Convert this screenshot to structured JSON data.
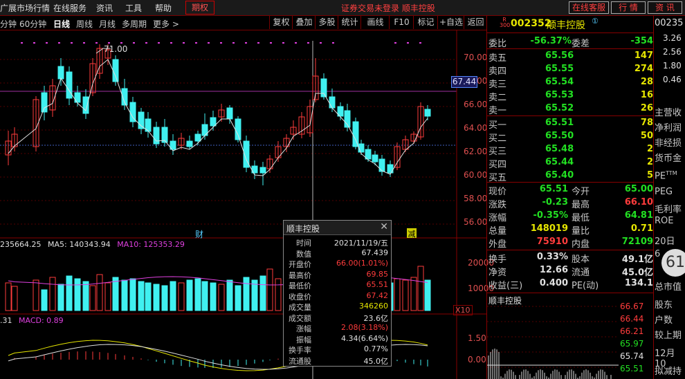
{
  "menu": {
    "items": [
      "广展市场行情",
      "在线服务",
      "资讯",
      "工具",
      "帮助"
    ],
    "active": "期权",
    "center_status": "证券交易未登录  顺丰控股",
    "buttons": [
      "在线客服",
      "行 情",
      "资 讯"
    ]
  },
  "toolbar": {
    "periods": [
      "分钟",
      "60分钟",
      "日线",
      "周线",
      "月线",
      "多周期",
      "更多 >"
    ],
    "active_period": "日线",
    "tools": [
      "复权",
      "叠加",
      "多股",
      "统计",
      "画线",
      "F10",
      "标记",
      "+自选",
      "返回"
    ]
  },
  "price_axis": [
    "70.00",
    "68.00",
    "66.00",
    "64.00",
    "62.00",
    "60.00",
    "58.00",
    "56.00"
  ],
  "price_marker": "67.44",
  "max_label": "71.00",
  "markers": {
    "cai": "财",
    "jian": "减"
  },
  "volume": {
    "legend_vol": "235664.25",
    "ma5_label": "MA5: 140343.94",
    "ma10_label": "MA10: 125353.29",
    "axis": [
      "20000",
      "10000"
    ],
    "unit": "X10"
  },
  "macd": {
    "legend_left": ".31",
    "macd_label": "MACD: 0.89",
    "axis": [
      "1.50",
      "0.00"
    ]
  },
  "tooltip": {
    "title": "顺丰控股",
    "rows": [
      {
        "label": "时间",
        "value": "2021/11/19/五",
        "color": "#e0e0e0"
      },
      {
        "label": "数值",
        "value": "67.439",
        "color": "#e0e0e0"
      },
      {
        "label": "开盘价",
        "value": "66.00(1.01%)",
        "color": "#ff3c3c"
      },
      {
        "label": "最高价",
        "value": "69.85",
        "color": "#ff3c3c"
      },
      {
        "label": "最低价",
        "value": "65.51",
        "color": "#ff3c3c"
      },
      {
        "label": "收盘价",
        "value": "67.42",
        "color": "#ff3c3c"
      },
      {
        "label": "成交量",
        "value": "346260",
        "color": "#e6e600"
      },
      {
        "label": "成交额",
        "value": "23.6亿",
        "color": "#e0e0e0"
      },
      {
        "label": "涨幅",
        "value": "2.08(3.18%)",
        "color": "#ff3c3c"
      },
      {
        "label": "振幅",
        "value": "4.34(6.64%)",
        "color": "#e0e0e0"
      },
      {
        "label": "换手率",
        "value": "0.77%",
        "color": "#e0e0e0"
      },
      {
        "label": "流通股",
        "value": "45.0亿",
        "color": "#e0e0e0"
      }
    ]
  },
  "stock": {
    "badge_top": "R",
    "badge_bottom": "300",
    "code": "002352",
    "name": "顺丰控股",
    "info_icon": "①",
    "weibi_label": "委比",
    "weibi": "-56.37%",
    "weicha_label": "委差",
    "weicha": "-354",
    "sells": [
      {
        "label": "卖五",
        "price": "65.56",
        "vol": "147"
      },
      {
        "label": "卖四",
        "price": "65.55",
        "vol": "274"
      },
      {
        "label": "卖三",
        "price": "65.54",
        "vol": "28"
      },
      {
        "label": "卖二",
        "price": "65.53",
        "vol": "16"
      },
      {
        "label": "卖一",
        "price": "65.52",
        "vol": "26"
      }
    ],
    "buys": [
      {
        "label": "买一",
        "price": "65.51",
        "vol": "78"
      },
      {
        "label": "买二",
        "price": "65.50",
        "vol": "50"
      },
      {
        "label": "买三",
        "price": "65.48",
        "vol": "2"
      },
      {
        "label": "买四",
        "price": "65.44",
        "vol": "2"
      },
      {
        "label": "买五",
        "price": "65.40",
        "vol": "5"
      }
    ],
    "quote": [
      {
        "l1": "现价",
        "v1": "65.51",
        "c1": "#22e022",
        "l2": "今开",
        "v2": "65.00",
        "c2": "#22e022"
      },
      {
        "l1": "涨跌",
        "v1": "-0.23",
        "c1": "#22e022",
        "l2": "最高",
        "v2": "66.10",
        "c2": "#ff3c3c"
      },
      {
        "l1": "涨幅",
        "v1": "-0.35%",
        "c1": "#22e022",
        "l2": "最低",
        "v2": "64.81",
        "c2": "#22e022"
      },
      {
        "l1": "总量",
        "v1": "148019",
        "c1": "#e6e600",
        "l2": "量比",
        "v2": "0.71",
        "c2": "#e6e600"
      },
      {
        "l1": "外盘",
        "v1": "75910",
        "c1": "#ff3c3c",
        "l2": "内盘",
        "v2": "72109",
        "c2": "#22e022"
      }
    ],
    "stats": [
      {
        "l1": "换手",
        "v1": "0.33%",
        "l2": "股本",
        "v2": "49.1亿"
      },
      {
        "l1": "净资",
        "v1": "12.66",
        "l2": "流通",
        "v2": "45.0亿"
      },
      {
        "l1": "收益(三)",
        "v1": "0.400",
        "l2": "PE(动)",
        "v2": "134.1"
      }
    ],
    "mini_title": "顺丰控股",
    "mini_axis": [
      "66.67",
      "66.44",
      "66.21",
      "65.97",
      "65.74",
      "65.51"
    ]
  },
  "far_right": {
    "code": "00235",
    "values": [
      "3.26",
      "2.56",
      "1.80",
      "0.46"
    ],
    "labels": [
      "主营收",
      "净利润",
      "非经损",
      "货币金",
      "PE",
      "PEG",
      "毛利率",
      "ROE",
      "20日",
      "6",
      "总市值",
      "股东",
      "户数",
      "较上期",
      "12月10",
      "拟减持"
    ],
    "pe_sup": "TTM",
    "float_num": "61"
  }
}
